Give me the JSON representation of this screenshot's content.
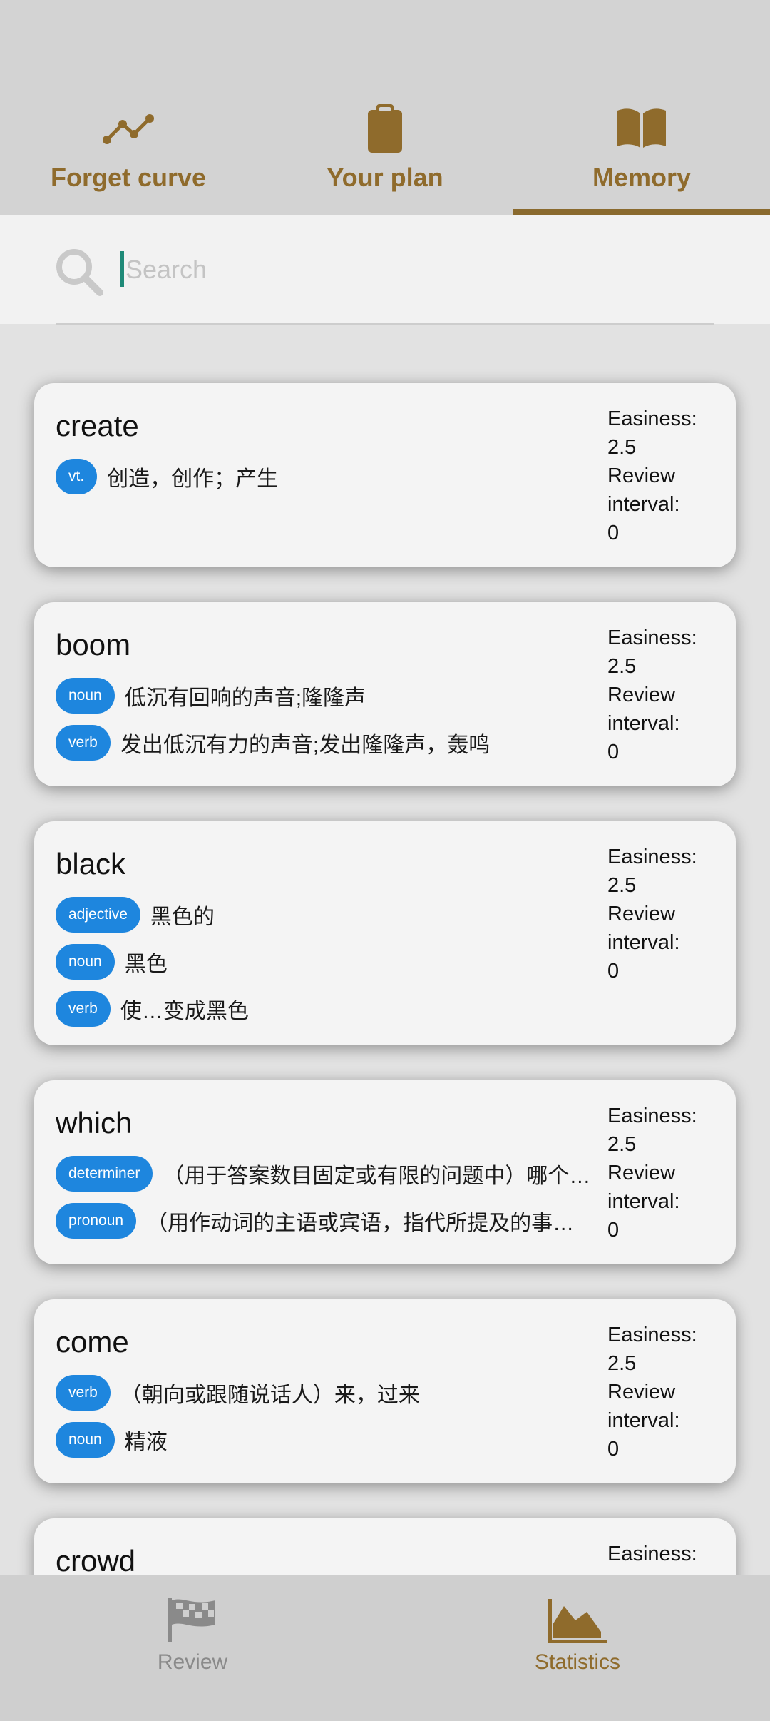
{
  "tabs": [
    {
      "label": "Forget curve",
      "icon": "line-chart-icon",
      "active": false
    },
    {
      "label": "Your plan",
      "icon": "clipboard-icon",
      "active": false
    },
    {
      "label": "Memory",
      "icon": "book-icon",
      "active": true
    }
  ],
  "search": {
    "placeholder": "Search",
    "value": ""
  },
  "stat_labels": {
    "easiness": "Easiness:",
    "review_interval": "Review interval:"
  },
  "cards": [
    {
      "word": "create",
      "meanings": [
        {
          "pos": "vt.",
          "def": "创造，创作；产生"
        }
      ],
      "easiness": "2.5",
      "interval": "0"
    },
    {
      "word": "boom",
      "meanings": [
        {
          "pos": "noun",
          "def": "低沉有回响的声音;隆隆声"
        },
        {
          "pos": "verb",
          "def": "发出低沉有力的声音;发出隆隆声，轰鸣"
        }
      ],
      "easiness": "2.5",
      "interval": "0"
    },
    {
      "word": "black",
      "meanings": [
        {
          "pos": "adjective",
          "def": "黑色的"
        },
        {
          "pos": "noun",
          "def": "黑色"
        },
        {
          "pos": "verb",
          "def": "使…变成黑色"
        }
      ],
      "easiness": "2.5",
      "interval": "0"
    },
    {
      "word": "which",
      "meanings": [
        {
          "pos": "determiner",
          "def": "（用于答案数目固定或有限的问题中）哪个…"
        },
        {
          "pos": "pronoun",
          "def": "（用作动词的主语或宾语，指代所提及的事…"
        }
      ],
      "easiness": "2.5",
      "interval": "0"
    },
    {
      "word": "come",
      "meanings": [
        {
          "pos": "verb",
          "def": "（朝向或跟随说话人）来，过来"
        },
        {
          "pos": "noun",
          "def": "精液"
        }
      ],
      "easiness": "2.5",
      "interval": "0"
    },
    {
      "word": "crowd",
      "meanings": [],
      "easiness": "",
      "interval": ""
    }
  ],
  "bottom_nav": [
    {
      "label": "Review",
      "icon": "checkered-flag-icon",
      "active": false
    },
    {
      "label": "Statistics",
      "icon": "area-chart-icon",
      "active": true
    }
  ],
  "colors": {
    "accent": "#8a6a2e",
    "pos_badge": "#1e86de",
    "inactive": "#8a8a8a"
  }
}
